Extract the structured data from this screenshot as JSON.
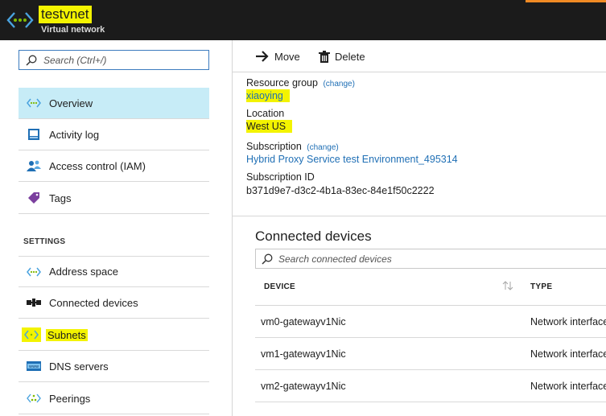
{
  "header": {
    "title": "testvnet",
    "subtitle": "Virtual network"
  },
  "nav": {
    "search_placeholder": "Search (Ctrl+/)",
    "items": [
      {
        "label": "Overview",
        "icon": "vnet-icon"
      },
      {
        "label": "Activity log",
        "icon": "activity-log-icon"
      },
      {
        "label": "Access control (IAM)",
        "icon": "iam-icon"
      },
      {
        "label": "Tags",
        "icon": "tag-icon"
      }
    ],
    "settings_heading": "SETTINGS",
    "settings_items": [
      {
        "label": "Address space",
        "icon": "vnet-icon"
      },
      {
        "label": "Connected devices",
        "icon": "connected-devices-icon"
      },
      {
        "label": "Subnets",
        "icon": "subnet-icon"
      },
      {
        "label": "DNS servers",
        "icon": "dns-icon"
      },
      {
        "label": "Peerings",
        "icon": "peering-icon"
      }
    ]
  },
  "toolbar": {
    "move_label": "Move",
    "delete_label": "Delete"
  },
  "essentials": {
    "resource_group_label": "Resource group",
    "resource_group_change": "(change)",
    "resource_group_value": "xiaoying",
    "location_label": "Location",
    "location_value": "West US",
    "subscription_label": "Subscription",
    "subscription_change": "(change)",
    "subscription_value": "Hybrid Proxy Service test Environment_495314",
    "subscription_id_label": "Subscription ID",
    "subscription_id_value": "b371d9e7-d3c2-4b1a-83ec-84e1f50c2222"
  },
  "connected_devices": {
    "title": "Connected devices",
    "search_placeholder": "Search connected devices",
    "columns": [
      "DEVICE",
      "TYPE"
    ],
    "rows": [
      {
        "device": "vm0-gatewayv1Nic",
        "type": "Network interface"
      },
      {
        "device": "vm1-gatewayv1Nic",
        "type": "Network interface"
      },
      {
        "device": "vm2-gatewayv1Nic",
        "type": "Network interface"
      }
    ]
  },
  "colors": {
    "header_bg": "#1b1b1b",
    "highlight": "#f3f300",
    "selected_bg": "#c7ecf7",
    "link": "#1f6fb5",
    "accent": "#f08a24"
  }
}
